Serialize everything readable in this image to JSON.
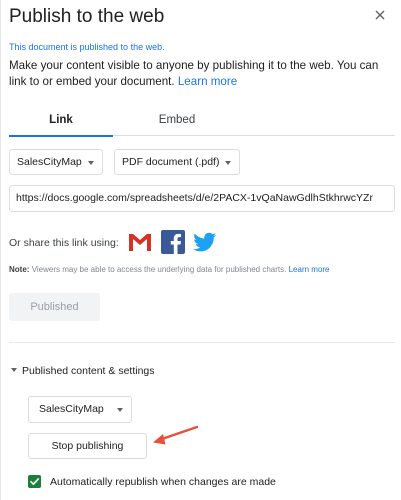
{
  "dialog": {
    "title": "Publish to the web",
    "close_icon": "close-icon",
    "published_note": "This document is published to the web.",
    "description": "Make your content visible to anyone by publishing it to the web. You can link to or embed your document.",
    "learn_more": "Learn more"
  },
  "tabs": [
    {
      "label": "Link",
      "active": true
    },
    {
      "label": "Embed",
      "active": false
    }
  ],
  "link_settings": {
    "sheet_select": "SalesCityMap",
    "format_select": "PDF document (.pdf)",
    "url": "https://docs.google.com/spreadsheets/d/e/2PACX-1vQaNawGdlhStkhrwcYZr"
  },
  "share": {
    "label": "Or share this link using:",
    "icons": [
      "gmail-icon",
      "facebook-icon",
      "twitter-icon"
    ]
  },
  "note": {
    "prefix": "Note:",
    "text": "Viewers may be able to access the underlying data for published charts.",
    "learn_more": "Learn more"
  },
  "published_button": "Published",
  "published_content": {
    "toggle_label": "Published content & settings",
    "sheet_select": "SalesCityMap",
    "stop_button": "Stop publishing",
    "auto_republish_label": "Automatically republish when changes are made",
    "auto_republish_checked": true
  },
  "colors": {
    "accent": "#1a73e8",
    "checkbox": "#188038",
    "arrow": "#e8503a",
    "gmail_red": "#d93025",
    "facebook_blue": "#3b5998",
    "twitter_blue": "#1da1f2"
  }
}
